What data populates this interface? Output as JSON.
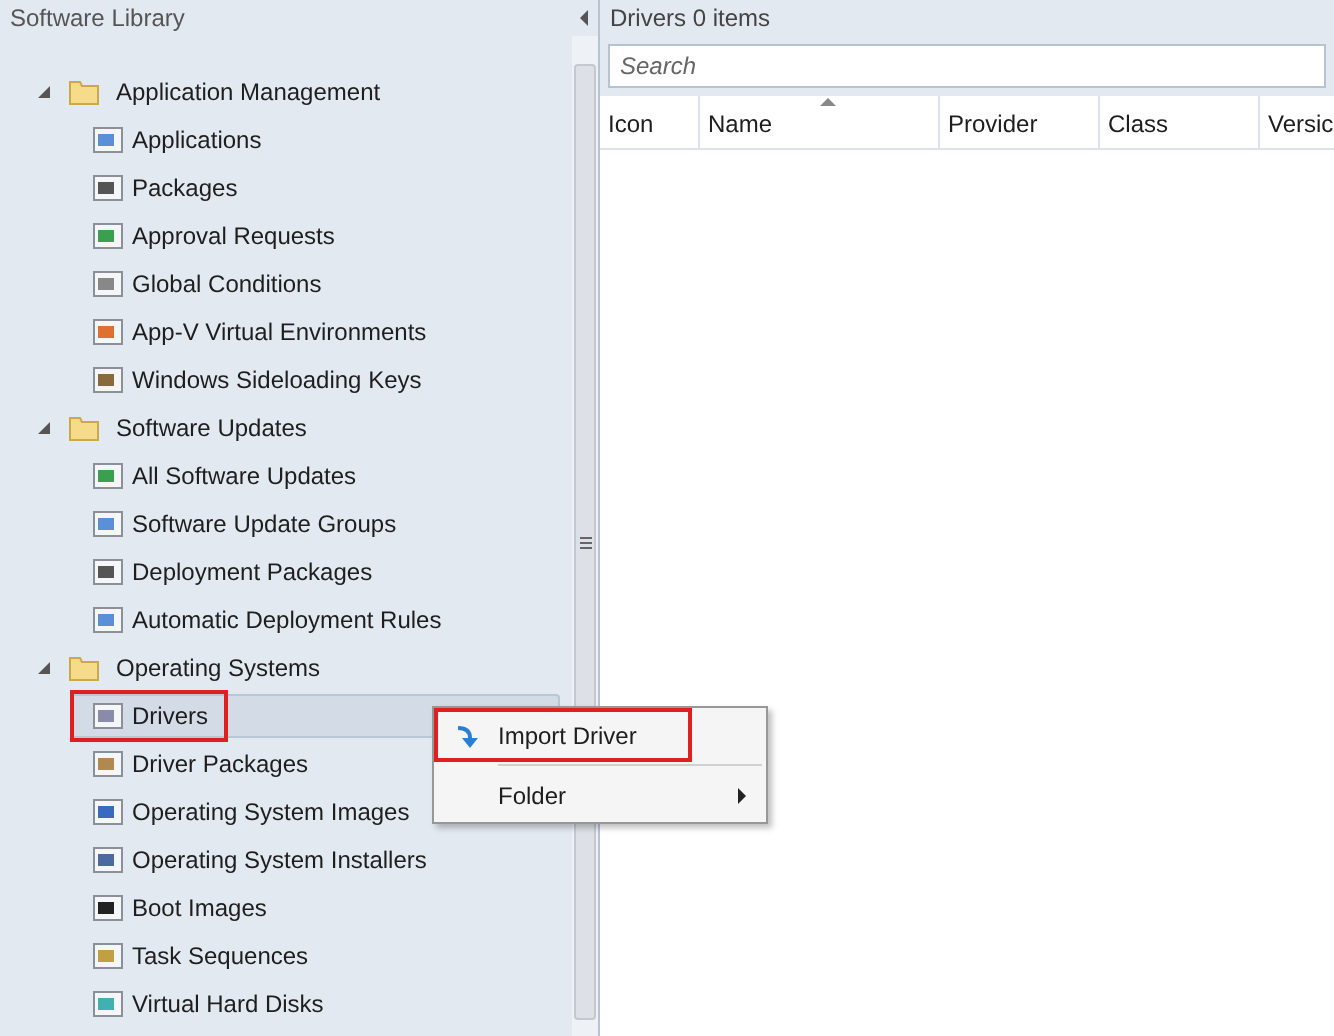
{
  "navigation": {
    "title": "Software Library",
    "tree": [
      {
        "label": "Application Management",
        "expanded": true,
        "children": [
          {
            "label": "Applications",
            "selected": false,
            "highlighted": false
          },
          {
            "label": "Packages",
            "selected": false,
            "highlighted": false
          },
          {
            "label": "Approval Requests",
            "selected": false,
            "highlighted": false
          },
          {
            "label": "Global Conditions",
            "selected": false,
            "highlighted": false
          },
          {
            "label": "App-V Virtual Environments",
            "selected": false,
            "highlighted": false
          },
          {
            "label": "Windows Sideloading Keys",
            "selected": false,
            "highlighted": false
          }
        ]
      },
      {
        "label": "Software Updates",
        "expanded": true,
        "children": [
          {
            "label": "All Software Updates",
            "selected": false,
            "highlighted": false
          },
          {
            "label": "Software Update Groups",
            "selected": false,
            "highlighted": false
          },
          {
            "label": "Deployment Packages",
            "selected": false,
            "highlighted": false
          },
          {
            "label": "Automatic Deployment Rules",
            "selected": false,
            "highlighted": false
          }
        ]
      },
      {
        "label": "Operating Systems",
        "expanded": true,
        "children": [
          {
            "label": "Drivers",
            "selected": true,
            "highlighted": true
          },
          {
            "label": "Driver Packages",
            "selected": false,
            "highlighted": false
          },
          {
            "label": "Operating System Images",
            "selected": false,
            "highlighted": false
          },
          {
            "label": "Operating System Installers",
            "selected": false,
            "highlighted": false
          },
          {
            "label": "Boot Images",
            "selected": false,
            "highlighted": false
          },
          {
            "label": "Task Sequences",
            "selected": false,
            "highlighted": false
          },
          {
            "label": "Virtual Hard Disks",
            "selected": false,
            "highlighted": false
          }
        ]
      }
    ]
  },
  "content": {
    "title": "Drivers 0 items",
    "search": {
      "placeholder": "Search"
    },
    "table": {
      "columns": [
        {
          "label": "Icon",
          "sorted": false
        },
        {
          "label": "Name",
          "sorted": true
        },
        {
          "label": "Provider",
          "sorted": false
        },
        {
          "label": "Class",
          "sorted": false
        },
        {
          "label": "Versic",
          "sorted": false
        }
      ]
    }
  },
  "context_menu": {
    "items": [
      {
        "label": "Import Driver",
        "has_submenu": false,
        "highlighted": true
      },
      {
        "label": "Folder",
        "has_submenu": true,
        "highlighted": false
      }
    ]
  }
}
